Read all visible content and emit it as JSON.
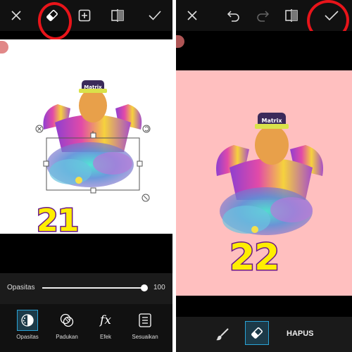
{
  "left": {
    "step_number": "21",
    "opacity_label": "Opasitas",
    "opacity_value": "100",
    "opacity_fraction": 1.0,
    "tabs": [
      {
        "label": "Opasitas",
        "icon": "opacity-icon",
        "active": true
      },
      {
        "label": "Padukan",
        "icon": "blend-icon",
        "active": false
      },
      {
        "label": "Efek",
        "icon": "fx-icon",
        "active": false
      },
      {
        "label": "Sesuaikan",
        "icon": "adjust-icon",
        "active": false
      }
    ],
    "toolbar_icons": [
      "close-icon",
      "eraser-icon",
      "add-icon",
      "flip-icon",
      "check-icon"
    ]
  },
  "right": {
    "step_number": "22",
    "erase_label": "HAPUS",
    "toolbar_icons": [
      "close-icon",
      "undo-icon",
      "redo-icon",
      "compare-icon",
      "check-icon"
    ]
  },
  "colors": {
    "highlight": "#e8141a",
    "accent": "#2aa3d6",
    "canvas_pink": "#ffbfbf",
    "number_fill": "#ffee00",
    "number_stroke": "#6a1a86"
  }
}
